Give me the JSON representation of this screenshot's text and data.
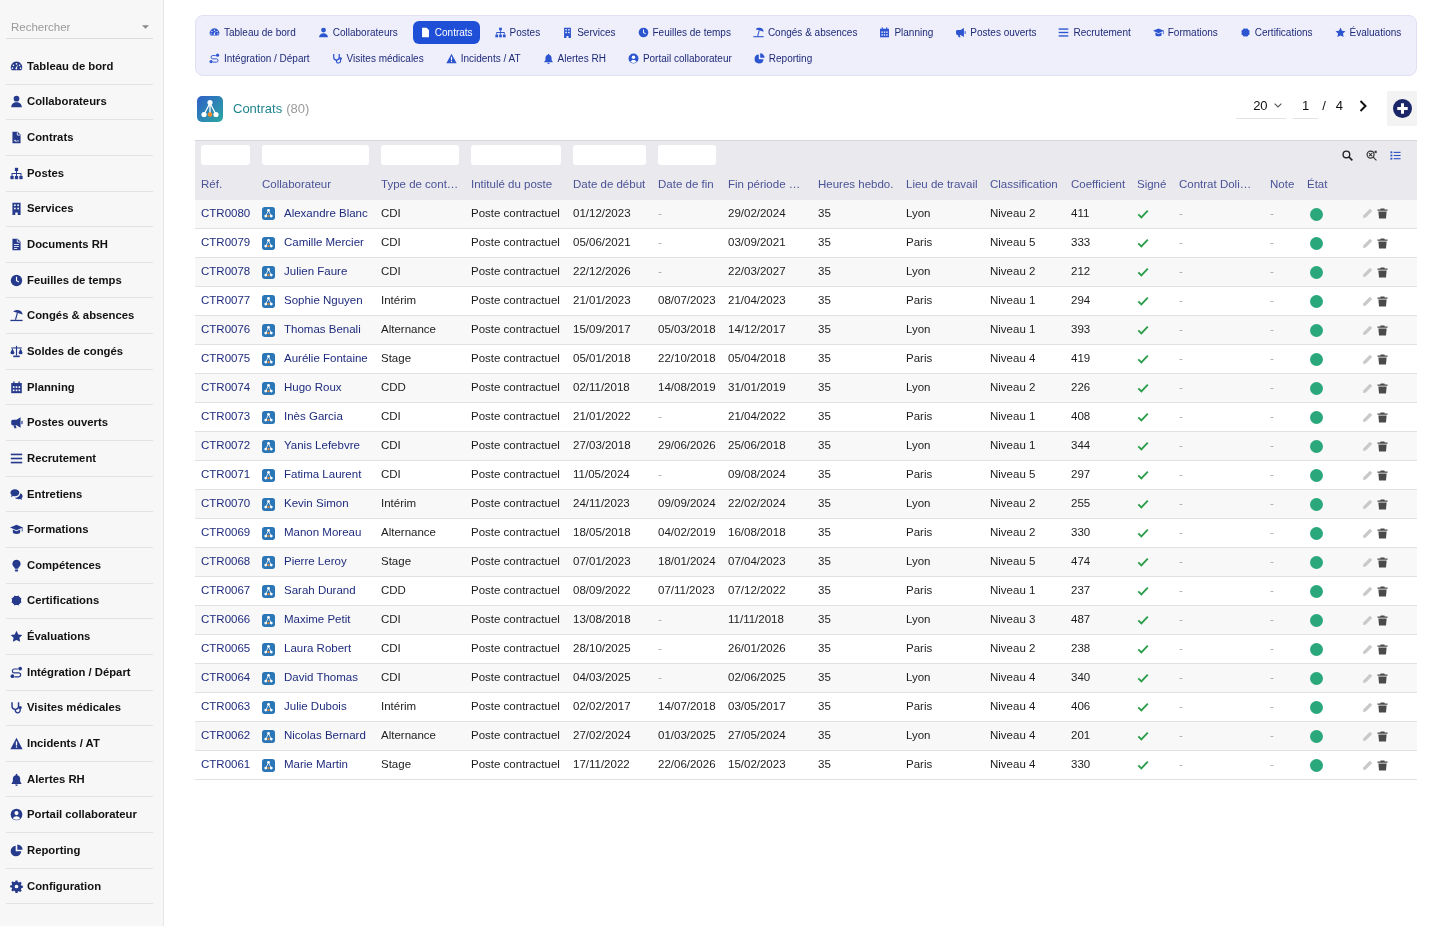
{
  "sidebar": {
    "search": {
      "placeholder": "Rechercher"
    },
    "items": [
      {
        "label": "Tableau de bord",
        "selected": false
      },
      {
        "label": "Collaborateurs",
        "selected": false
      },
      {
        "label": "Contrats",
        "selected": false
      },
      {
        "label": "Postes",
        "selected": false
      },
      {
        "label": "Services",
        "selected": false
      },
      {
        "label": "Documents RH",
        "selected": false
      },
      {
        "label": "Feuilles de temps",
        "selected": false
      },
      {
        "label": "Congés & absences",
        "selected": false
      },
      {
        "label": "Soldes de congés",
        "selected": false
      },
      {
        "label": "Planning",
        "selected": false
      },
      {
        "label": "Postes ouverts",
        "selected": false
      },
      {
        "label": "Recrutement",
        "selected": false
      },
      {
        "label": "Entretiens",
        "selected": false
      },
      {
        "label": "Formations",
        "selected": false
      },
      {
        "label": "Compétences",
        "selected": false
      },
      {
        "label": "Certifications",
        "selected": false
      },
      {
        "label": "Évaluations",
        "selected": false
      },
      {
        "label": "Intégration / Départ",
        "selected": false
      },
      {
        "label": "Visites médicales",
        "selected": false
      },
      {
        "label": "Incidents / AT",
        "selected": false
      },
      {
        "label": "Alertes RH",
        "selected": false
      },
      {
        "label": "Portail collaborateur",
        "selected": false
      },
      {
        "label": "Reporting",
        "selected": false
      },
      {
        "label": "Configuration",
        "selected": false
      }
    ]
  },
  "nav": {
    "tab_rows": [
      [
        {
          "label": "Tableau de bord",
          "selected": false
        },
        {
          "label": "Collaborateurs",
          "selected": false
        },
        {
          "label": "Contrats",
          "selected": true
        },
        {
          "label": "Postes",
          "selected": false
        },
        {
          "label": "Services",
          "selected": false
        },
        {
          "label": "Feuilles de temps",
          "selected": false
        },
        {
          "label": "Congés & absences",
          "selected": false
        },
        {
          "label": "Planning",
          "selected": false
        },
        {
          "label": "Postes ouverts",
          "selected": false
        },
        {
          "label": "Recrutement",
          "selected": false
        },
        {
          "label": "Formations",
          "selected": false
        },
        {
          "label": "Certifications",
          "selected": false
        },
        {
          "label": "Évaluations",
          "selected": false
        }
      ],
      [
        {
          "label": "Intégration / Départ",
          "selected": false
        },
        {
          "label": "Visites médicales",
          "selected": false
        },
        {
          "label": "Incidents / AT",
          "selected": false
        },
        {
          "label": "Alertes RH",
          "selected": false
        },
        {
          "label": "Portail collaborateur",
          "selected": false
        },
        {
          "label": "Reporting",
          "selected": false
        }
      ]
    ]
  },
  "header": {
    "title": "Contrats",
    "count": "(80)",
    "pagination": {
      "page_size": "20",
      "page": "1",
      "separator": "/",
      "total_pages": "4"
    }
  },
  "table": {
    "columns": [
      {
        "label": "Réf.",
        "filter": true
      },
      {
        "label": "Collaborateur",
        "filter": true
      },
      {
        "label": "Type de cont…",
        "filter": true
      },
      {
        "label": "Intitulé du poste",
        "filter": true
      },
      {
        "label": "Date de début",
        "filter": true
      },
      {
        "label": "Date de fin",
        "filter": true
      },
      {
        "label": "Fin période …",
        "filter": false
      },
      {
        "label": "Heures hebdo.",
        "filter": false
      },
      {
        "label": "Lieu de travail",
        "filter": false
      },
      {
        "label": "Classification",
        "filter": false
      },
      {
        "label": "Coefficient",
        "filter": false
      },
      {
        "label": "Signé",
        "filter": false
      },
      {
        "label": "Contrat Doli…",
        "filter": false
      },
      {
        "label": "Note",
        "filter": false
      },
      {
        "label": "État",
        "filter": false
      }
    ],
    "rows": [
      {
        "ref": "CTR0080",
        "employee": "Alexandre Blanc",
        "type": "CDI",
        "job_title": "Poste contractuel",
        "start_date": "01/12/2023",
        "end_date": {
          "text": "-",
          "muted": true
        },
        "trial_end": "29/02/2024",
        "weekly_hours": "35",
        "workplace": "Lyon",
        "classification": "Niveau 2",
        "coefficient": "411",
        "signed": true,
        "doli_contract": "-",
        "note": "-",
        "color": "#2aa87c"
      },
      {
        "ref": "CTR0079",
        "employee": "Camille Mercier",
        "type": "CDI",
        "job_title": "Poste contractuel",
        "start_date": "05/06/2021",
        "end_date": {
          "text": "-",
          "muted": true
        },
        "trial_end": "03/09/2021",
        "weekly_hours": "35",
        "workplace": "Paris",
        "classification": "Niveau 5",
        "coefficient": "333",
        "signed": true,
        "doli_contract": "-",
        "note": "-",
        "color": "#2aa87c"
      },
      {
        "ref": "CTR0078",
        "employee": "Julien Faure",
        "type": "CDI",
        "job_title": "Poste contractuel",
        "start_date": "22/12/2026",
        "end_date": {
          "text": "-",
          "muted": true
        },
        "trial_end": "22/03/2027",
        "weekly_hours": "35",
        "workplace": "Lyon",
        "classification": "Niveau 2",
        "coefficient": "212",
        "signed": true,
        "doli_contract": "-",
        "note": "-",
        "color": "#2aa87c"
      },
      {
        "ref": "CTR0077",
        "employee": "Sophie Nguyen",
        "type": "Intérim",
        "job_title": "Poste contractuel",
        "start_date": "21/01/2023",
        "end_date": {
          "text": "08/07/2023",
          "muted": false
        },
        "trial_end": "21/04/2023",
        "weekly_hours": "35",
        "workplace": "Paris",
        "classification": "Niveau 1",
        "coefficient": "294",
        "signed": true,
        "doli_contract": "-",
        "note": "-",
        "color": "#2aa87c"
      },
      {
        "ref": "CTR0076",
        "employee": "Thomas Benali",
        "type": "Alternance",
        "job_title": "Poste contractuel",
        "start_date": "15/09/2017",
        "end_date": {
          "text": "05/03/2018",
          "muted": false
        },
        "trial_end": "14/12/2017",
        "weekly_hours": "35",
        "workplace": "Lyon",
        "classification": "Niveau 1",
        "coefficient": "393",
        "signed": true,
        "doli_contract": "-",
        "note": "-",
        "color": "#2aa87c"
      },
      {
        "ref": "CTR0075",
        "employee": "Aurélie Fontaine",
        "type": "Stage",
        "job_title": "Poste contractuel",
        "start_date": "05/01/2018",
        "end_date": {
          "text": "22/10/2018",
          "muted": false
        },
        "trial_end": "05/04/2018",
        "weekly_hours": "35",
        "workplace": "Paris",
        "classification": "Niveau 4",
        "coefficient": "419",
        "signed": true,
        "doli_contract": "-",
        "note": "-",
        "color": "#2aa87c"
      },
      {
        "ref": "CTR0074",
        "employee": "Hugo Roux",
        "type": "CDD",
        "job_title": "Poste contractuel",
        "start_date": "02/11/2018",
        "end_date": {
          "text": "14/08/2019",
          "muted": false
        },
        "trial_end": "31/01/2019",
        "weekly_hours": "35",
        "workplace": "Lyon",
        "classification": "Niveau 2",
        "coefficient": "226",
        "signed": true,
        "doli_contract": "-",
        "note": "-",
        "color": "#2aa87c"
      },
      {
        "ref": "CTR0073",
        "employee": "Inès Garcia",
        "type": "CDI",
        "job_title": "Poste contractuel",
        "start_date": "21/01/2022",
        "end_date": {
          "text": "-",
          "muted": true
        },
        "trial_end": "21/04/2022",
        "weekly_hours": "35",
        "workplace": "Paris",
        "classification": "Niveau 1",
        "coefficient": "408",
        "signed": true,
        "doli_contract": "-",
        "note": "-",
        "color": "#2aa87c"
      },
      {
        "ref": "CTR0072",
        "employee": "Yanis Lefebvre",
        "type": "CDI",
        "job_title": "Poste contractuel",
        "start_date": "27/03/2018",
        "end_date": {
          "text": "29/06/2026",
          "muted": false
        },
        "trial_end": "25/06/2018",
        "weekly_hours": "35",
        "workplace": "Lyon",
        "classification": "Niveau 1",
        "coefficient": "344",
        "signed": true,
        "doli_contract": "-",
        "note": "-",
        "color": "#2aa87c"
      },
      {
        "ref": "CTR0071",
        "employee": "Fatima Laurent",
        "type": "CDI",
        "job_title": "Poste contractuel",
        "start_date": "11/05/2024",
        "end_date": {
          "text": "-",
          "muted": true
        },
        "trial_end": "09/08/2024",
        "weekly_hours": "35",
        "workplace": "Paris",
        "classification": "Niveau 5",
        "coefficient": "297",
        "signed": true,
        "doli_contract": "-",
        "note": "-",
        "color": "#2aa87c"
      },
      {
        "ref": "CTR0070",
        "employee": "Kevin Simon",
        "type": "Intérim",
        "job_title": "Poste contractuel",
        "start_date": "24/11/2023",
        "end_date": {
          "text": "09/09/2024",
          "muted": false
        },
        "trial_end": "22/02/2024",
        "weekly_hours": "35",
        "workplace": "Lyon",
        "classification": "Niveau 2",
        "coefficient": "255",
        "signed": true,
        "doli_contract": "-",
        "note": "-",
        "color": "#2aa87c"
      },
      {
        "ref": "CTR0069",
        "employee": "Manon Moreau",
        "type": "Alternance",
        "job_title": "Poste contractuel",
        "start_date": "18/05/2018",
        "end_date": {
          "text": "04/02/2019",
          "muted": false
        },
        "trial_end": "16/08/2018",
        "weekly_hours": "35",
        "workplace": "Paris",
        "classification": "Niveau 2",
        "coefficient": "330",
        "signed": true,
        "doli_contract": "-",
        "note": "-",
        "color": "#2aa87c"
      },
      {
        "ref": "CTR0068",
        "employee": "Pierre Leroy",
        "type": "Stage",
        "job_title": "Poste contractuel",
        "start_date": "07/01/2023",
        "end_date": {
          "text": "18/01/2024",
          "muted": false
        },
        "trial_end": "07/04/2023",
        "weekly_hours": "35",
        "workplace": "Lyon",
        "classification": "Niveau 5",
        "coefficient": "474",
        "signed": true,
        "doli_contract": "-",
        "note": "-",
        "color": "#2aa87c"
      },
      {
        "ref": "CTR0067",
        "employee": "Sarah Durand",
        "type": "CDD",
        "job_title": "Poste contractuel",
        "start_date": "08/09/2022",
        "end_date": {
          "text": "07/11/2023",
          "muted": false
        },
        "trial_end": "07/12/2022",
        "weekly_hours": "35",
        "workplace": "Paris",
        "classification": "Niveau 1",
        "coefficient": "237",
        "signed": true,
        "doli_contract": "-",
        "note": "-",
        "color": "#2aa87c"
      },
      {
        "ref": "CTR0066",
        "employee": "Maxime Petit",
        "type": "CDI",
        "job_title": "Poste contractuel",
        "start_date": "13/08/2018",
        "end_date": {
          "text": "-",
          "muted": true
        },
        "trial_end": "11/11/2018",
        "weekly_hours": "35",
        "workplace": "Lyon",
        "classification": "Niveau 3",
        "coefficient": "487",
        "signed": true,
        "doli_contract": "-",
        "note": "-",
        "color": "#2aa87c"
      },
      {
        "ref": "CTR0065",
        "employee": "Laura Robert",
        "type": "CDI",
        "job_title": "Poste contractuel",
        "start_date": "28/10/2025",
        "end_date": {
          "text": "-",
          "muted": true
        },
        "trial_end": "26/01/2026",
        "weekly_hours": "35",
        "workplace": "Paris",
        "classification": "Niveau 2",
        "coefficient": "238",
        "signed": true,
        "doli_contract": "-",
        "note": "-",
        "color": "#2aa87c"
      },
      {
        "ref": "CTR0064",
        "employee": "David Thomas",
        "type": "CDI",
        "job_title": "Poste contractuel",
        "start_date": "04/03/2025",
        "end_date": {
          "text": "-",
          "muted": true
        },
        "trial_end": "02/06/2025",
        "weekly_hours": "35",
        "workplace": "Lyon",
        "classification": "Niveau 4",
        "coefficient": "340",
        "signed": true,
        "doli_contract": "-",
        "note": "-",
        "color": "#2aa87c"
      },
      {
        "ref": "CTR0063",
        "employee": "Julie Dubois",
        "type": "Intérim",
        "job_title": "Poste contractuel",
        "start_date": "02/02/2017",
        "end_date": {
          "text": "14/07/2018",
          "muted": false
        },
        "trial_end": "03/05/2017",
        "weekly_hours": "35",
        "workplace": "Paris",
        "classification": "Niveau 4",
        "coefficient": "406",
        "signed": true,
        "doli_contract": "-",
        "note": "-",
        "color": "#2aa87c"
      },
      {
        "ref": "CTR0062",
        "employee": "Nicolas Bernard",
        "type": "Alternance",
        "job_title": "Poste contractuel",
        "start_date": "27/02/2024",
        "end_date": {
          "text": "01/03/2025",
          "muted": false
        },
        "trial_end": "27/05/2024",
        "weekly_hours": "35",
        "workplace": "Lyon",
        "classification": "Niveau 4",
        "coefficient": "201",
        "signed": true,
        "doli_contract": "-",
        "note": "-",
        "color": "#2aa87c"
      },
      {
        "ref": "CTR0061",
        "employee": "Marie Martin",
        "type": "Stage",
        "job_title": "Poste contractuel",
        "start_date": "17/11/2022",
        "end_date": {
          "text": "22/06/2026",
          "muted": false
        },
        "trial_end": "15/02/2023",
        "weekly_hours": "35",
        "workplace": "Paris",
        "classification": "Niveau 4",
        "coefficient": "330",
        "signed": true,
        "doli_contract": "-",
        "note": "-",
        "color": "#2aa87c"
      }
    ]
  }
}
